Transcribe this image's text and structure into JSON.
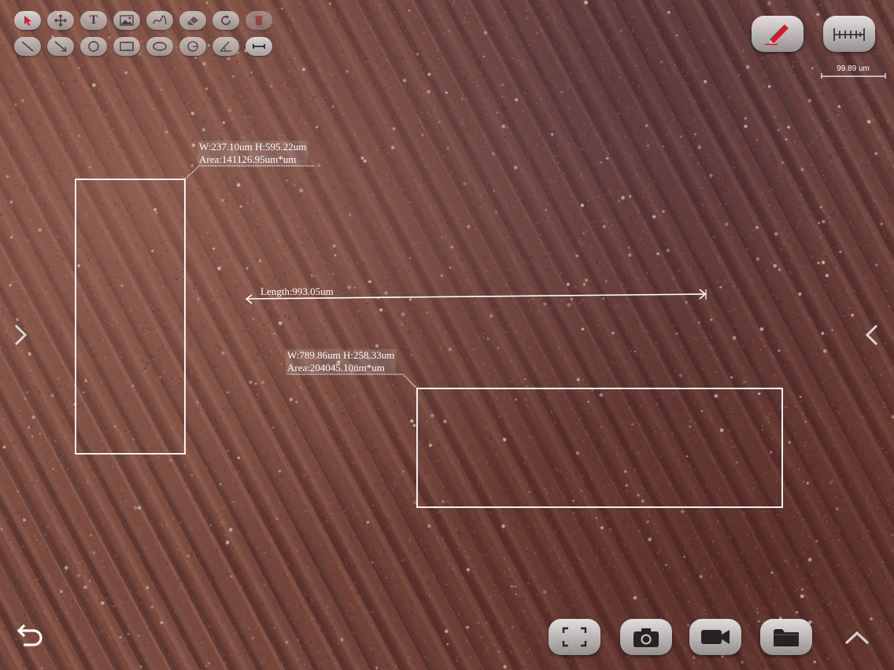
{
  "toolbar": {
    "row1": [
      {
        "name": "select-tool",
        "icon": "pointer-arrow-icon",
        "active": true
      },
      {
        "name": "move-tool",
        "icon": "move-cross-icon"
      },
      {
        "name": "text-tool",
        "icon": "text-icon",
        "label": "T"
      },
      {
        "name": "image-tool",
        "icon": "image-icon"
      },
      {
        "name": "freehand-tool",
        "icon": "freehand-icon"
      },
      {
        "name": "eraser-tool",
        "icon": "eraser-icon"
      },
      {
        "name": "rotate-tool",
        "icon": "rotate-icon"
      },
      {
        "name": "delete-tool",
        "icon": "trash-icon"
      }
    ],
    "row2": [
      {
        "name": "line-tool",
        "icon": "line-icon"
      },
      {
        "name": "arrow-line-tool",
        "icon": "arrow-line-icon"
      },
      {
        "name": "circle-tool",
        "icon": "circle-icon"
      },
      {
        "name": "rectangle-tool",
        "icon": "rectangle-icon"
      },
      {
        "name": "ellipse-tool",
        "icon": "ellipse-icon"
      },
      {
        "name": "arc-tool",
        "icon": "arc-icon"
      },
      {
        "name": "angle-tool",
        "icon": "angle-icon"
      },
      {
        "name": "length-tool",
        "icon": "length-measure-icon"
      }
    ]
  },
  "scale": {
    "label": "99.89 um"
  },
  "measurements": {
    "rect1": {
      "line1": "W:237.10um H:595.22um",
      "line2": "Area:141126.95um*um"
    },
    "line1": {
      "label": "Length:993.05um"
    },
    "rect2": {
      "line1": "W:789.86um H:258.33um",
      "line2": "Area:204045.10um*um"
    }
  },
  "bottom_buttons": [
    "fullscreen-icon",
    "camera-icon",
    "video-camera-icon",
    "folder-icon"
  ],
  "colors": {
    "specimen": "#7a4a3e",
    "annotation": "#ffffff",
    "active_tool": "#d61b2a",
    "pencil": "#d61b2a"
  }
}
